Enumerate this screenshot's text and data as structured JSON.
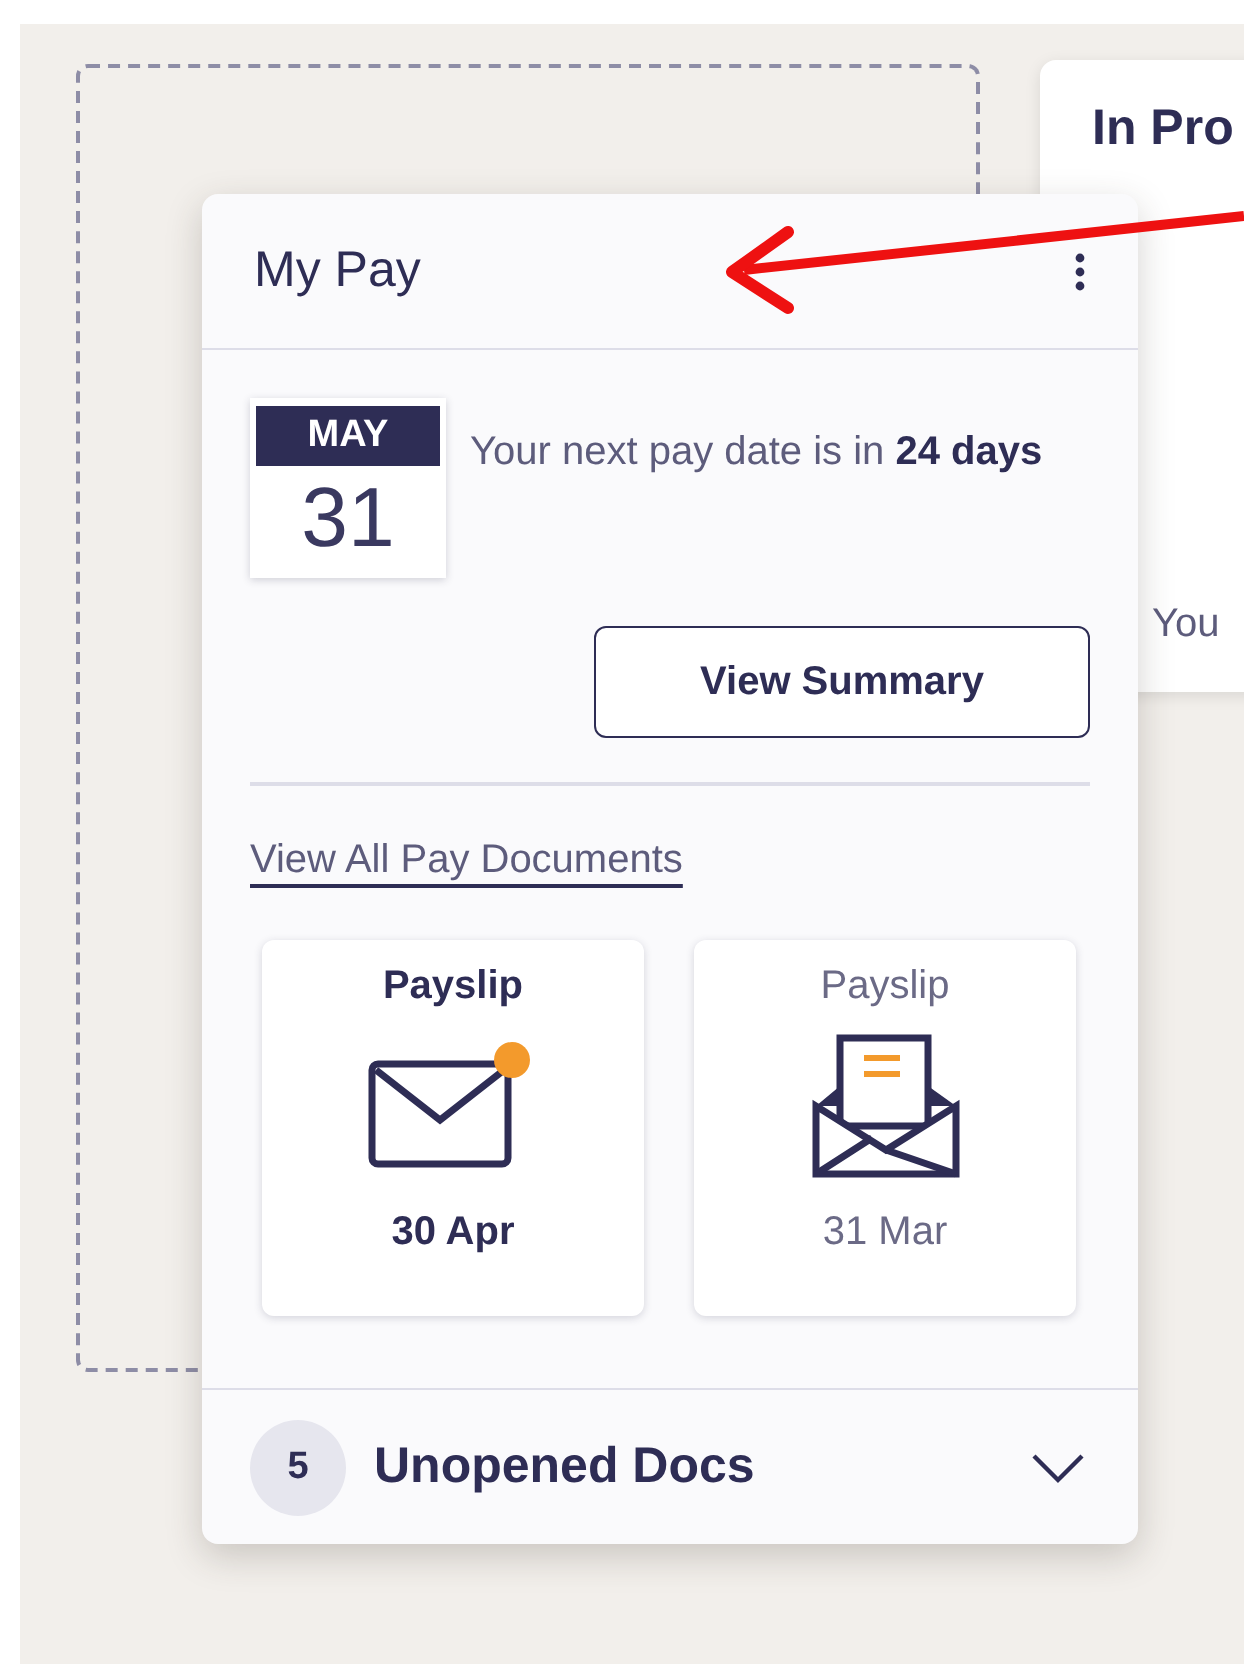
{
  "background_card": {
    "title": "In Pro",
    "text": "You"
  },
  "card": {
    "title": "My Pay",
    "pay_date": {
      "month": "MAY",
      "day": "31",
      "message": "Your next pay date is in **24 days**"
    },
    "summary_button": "View Summary",
    "documents_link": "View All Pay Documents",
    "documents": [
      {
        "title": "Payslip",
        "date": "30 Apr",
        "opened": false
      },
      {
        "title": "Payslip",
        "date": "31 Mar",
        "opened": true
      }
    ],
    "footer": {
      "count": "5",
      "label": "Unopened Docs",
      "expanded": false
    }
  }
}
